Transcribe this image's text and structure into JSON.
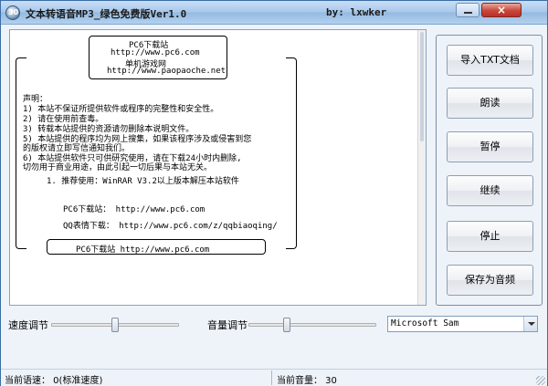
{
  "window": {
    "title": "文本转语音MP3_绿色免费版Ver1.0",
    "author": "by: lxwker",
    "app_icon_label": "30",
    "close_glyph": "×"
  },
  "document": {
    "frame_top_lines": [
      "PC6下载站",
      "http://www.pc6.com",
      "单机游戏网",
      "http://www.paopaoche.net"
    ],
    "statement_lines": [
      "声明：",
      "    1) 本站不保证所提供软件或程序的完整性和安全性。",
      "    2) 请在使用前查毒。",
      "    3) 转载本站提供的资源请勿删除本说明文件。",
      "    5) 本站提供的程序均为网上搜集，如果该程序涉及或侵害到您",
      "       的版权请立即写信通知我们。",
      "    6) 本站提供软件只可供研究使用，请在下载24小时内删除,",
      "       切勿用于商业用途，由此引起一切后果与本站无关。"
    ],
    "recommend": "1. 推荐使用：WinRAR V3.2以上版本解压本站软件",
    "site_line": "PC6下载站：   http://www.pc6.com",
    "qq_line": "QQ表情下载：  http://www.pc6.com/z/qqbiaoqing/",
    "frame_bottom": "PC6下载站   http://www.pc6.com"
  },
  "buttons": {
    "import": "导入TXT文档",
    "read": "朗读",
    "pause": "暂停",
    "resume": "继续",
    "stop": "停止",
    "save_audio": "保存为音频"
  },
  "controls": {
    "speed_label": "速度调节",
    "speed_value": 0,
    "speed_range": [
      -10,
      10
    ],
    "volume_label": "音量调节",
    "volume_value": 30,
    "volume_range": [
      0,
      100
    ],
    "voice_selected": "Microsoft Sam"
  },
  "status": {
    "speed_text": "当前语速： 0(标准速度)",
    "volume_text": "当前音量： 30"
  }
}
